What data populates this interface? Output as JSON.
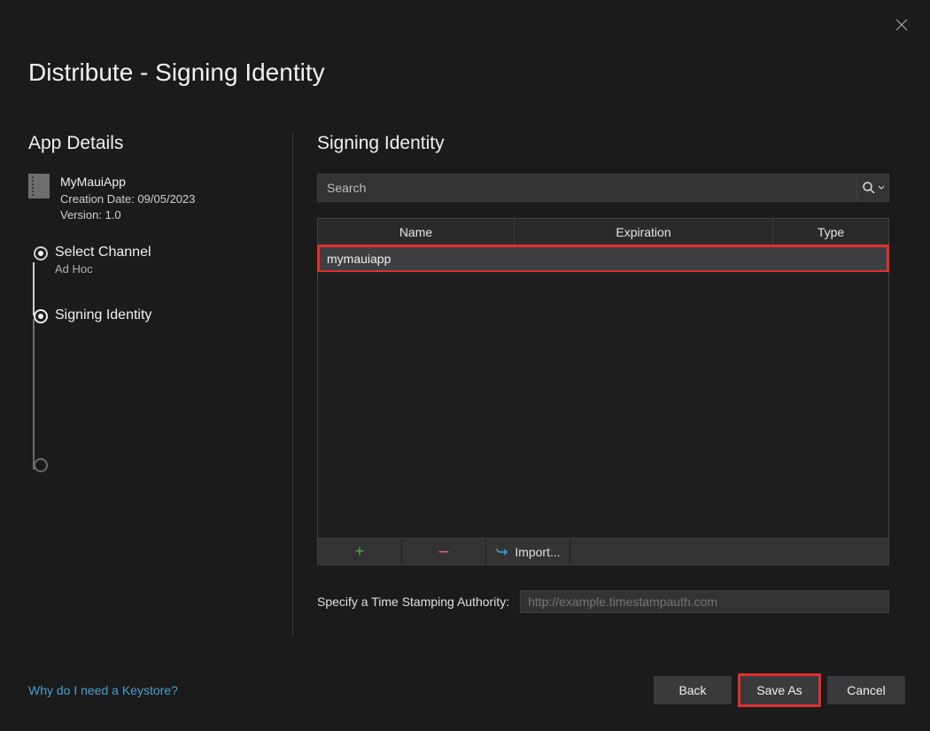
{
  "window": {
    "title": "Distribute - Signing Identity"
  },
  "left": {
    "heading": "App Details",
    "app": {
      "name": "MyMauiApp",
      "creation_label": "Creation Date: 09/05/2023",
      "version_label": "Version: 1.0"
    },
    "steps": [
      {
        "label": "Select Channel",
        "sublabel": "Ad Hoc"
      },
      {
        "label": "Signing Identity"
      }
    ]
  },
  "right": {
    "heading": "Signing Identity",
    "search_placeholder": "Search",
    "columns": {
      "name": "Name",
      "expiration": "Expiration",
      "type": "Type"
    },
    "rows": [
      {
        "name": "mymauiapp"
      }
    ],
    "toolbar": {
      "import": "Import..."
    },
    "tsa_label": "Specify a Time Stamping Authority:",
    "tsa_placeholder": "http://example.timestampauth.com"
  },
  "footer": {
    "link": "Why do I need a Keystore?",
    "back": "Back",
    "save_as": "Save As",
    "cancel": "Cancel"
  },
  "colors": {
    "highlight": "#e03030"
  }
}
